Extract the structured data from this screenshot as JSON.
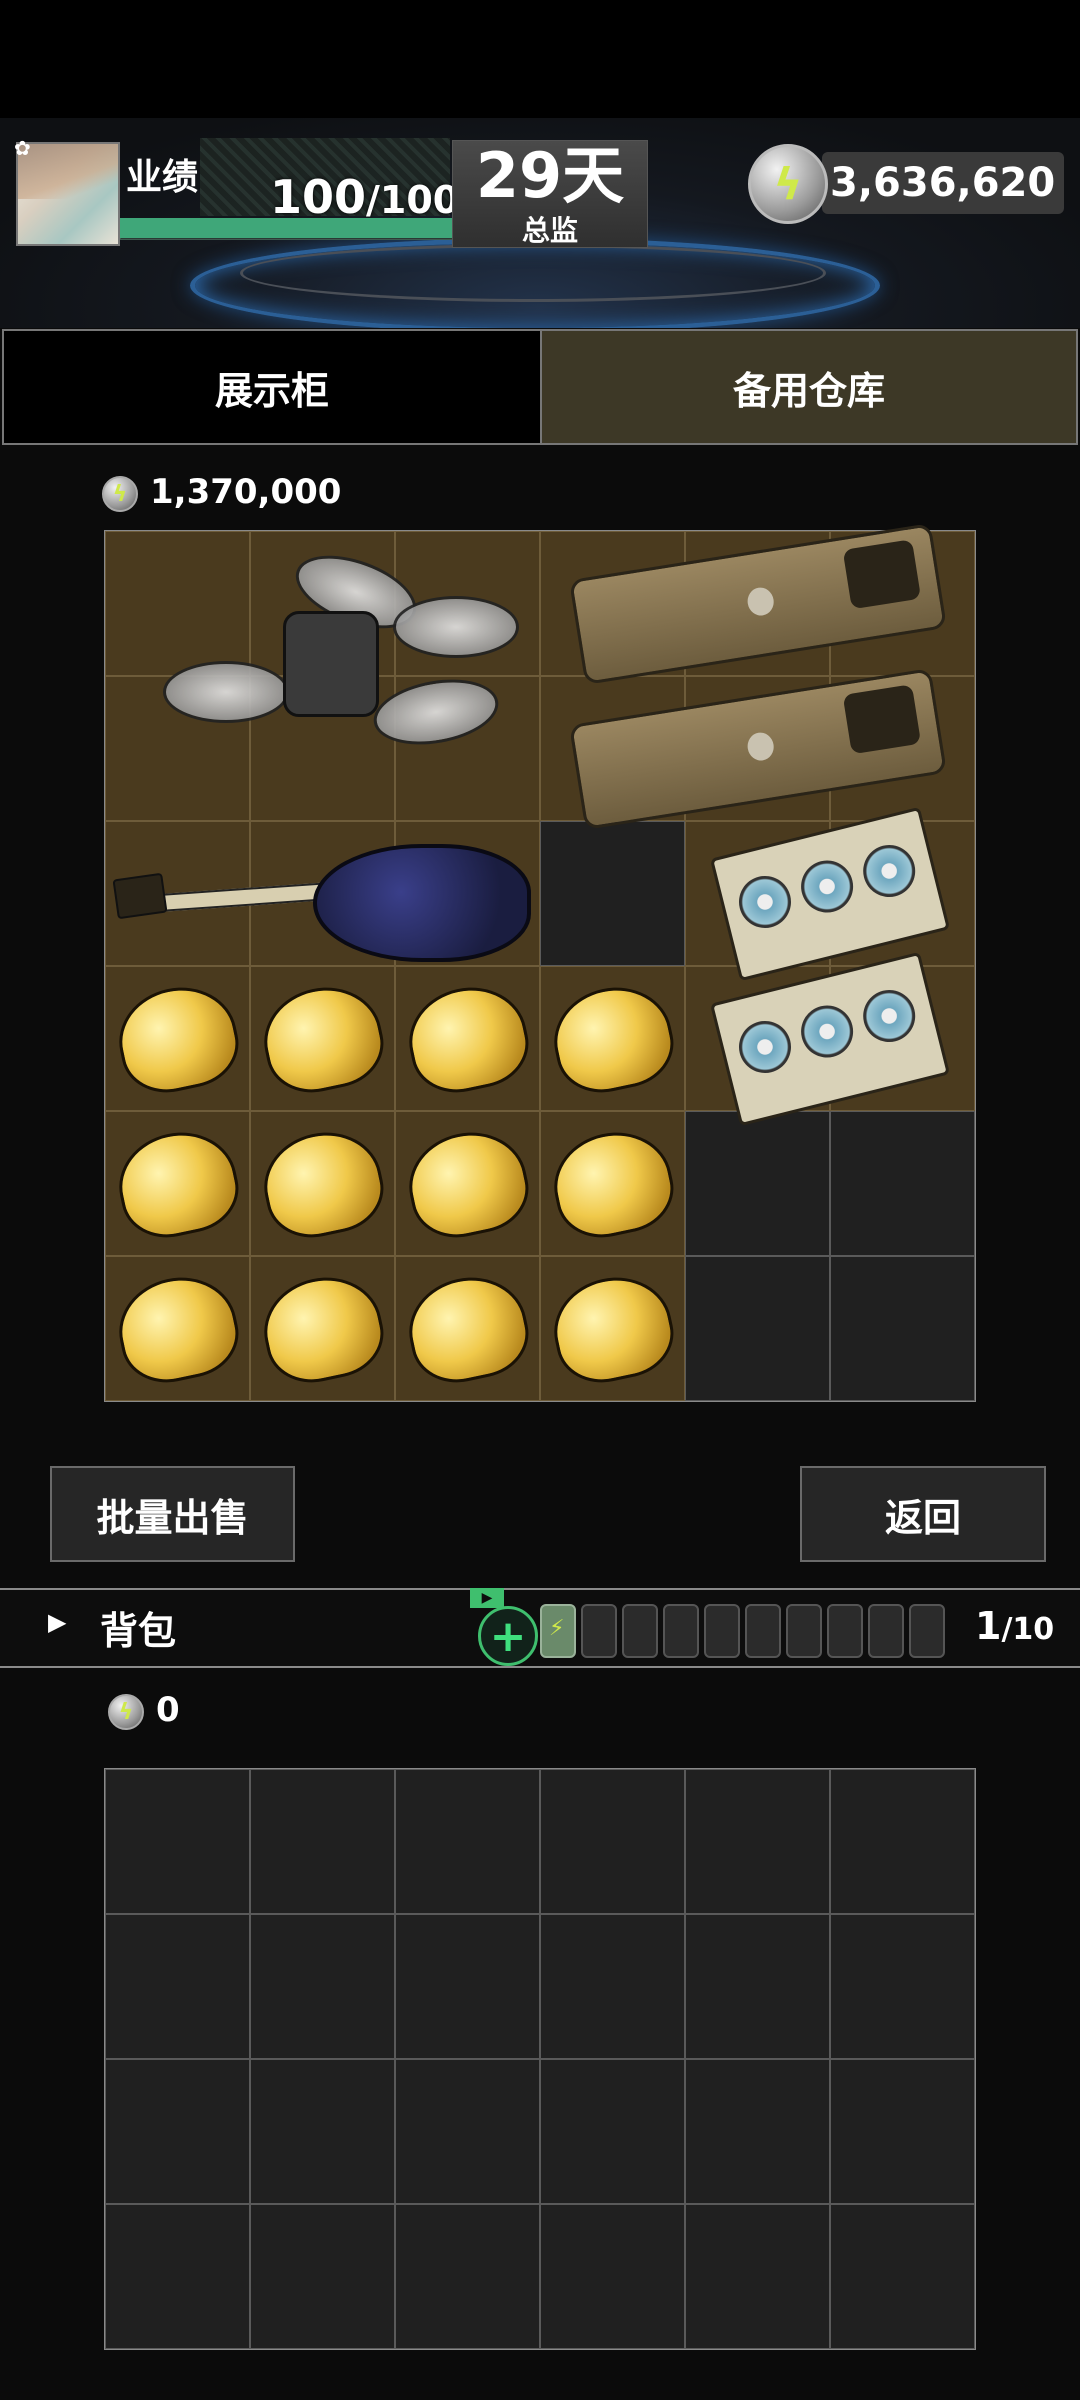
{
  "header": {
    "performance_label": "业绩",
    "performance_current": "100",
    "performance_max": "/100",
    "performance_fraction": 1.0,
    "days_value": "29天",
    "days_label": "总监",
    "coin_total": "3,636,620"
  },
  "tabs": [
    {
      "label": "展示柜",
      "active": false
    },
    {
      "label": "备用仓库",
      "active": true
    }
  ],
  "storage": {
    "value": "1,370,000",
    "items": [
      {
        "name": "drone",
        "col": 0,
        "row": 0,
        "w": 3,
        "h": 2
      },
      {
        "name": "phone",
        "col": 3,
        "row": 0,
        "w": 3,
        "h": 1
      },
      {
        "name": "phone",
        "col": 3,
        "row": 1,
        "w": 3,
        "h": 1
      },
      {
        "name": "guitar",
        "col": 0,
        "row": 2,
        "w": 3,
        "h": 1
      },
      {
        "name": "gpu",
        "col": 4,
        "row": 2,
        "w": 2,
        "h": 1
      },
      {
        "name": "gpu",
        "col": 4,
        "row": 3,
        "w": 2,
        "h": 1
      },
      {
        "name": "gold-nugget",
        "col": 0,
        "row": 3,
        "w": 1,
        "h": 1
      },
      {
        "name": "gold-nugget",
        "col": 1,
        "row": 3,
        "w": 1,
        "h": 1
      },
      {
        "name": "gold-nugget",
        "col": 2,
        "row": 3,
        "w": 1,
        "h": 1
      },
      {
        "name": "gold-nugget",
        "col": 3,
        "row": 3,
        "w": 1,
        "h": 1
      },
      {
        "name": "gold-nugget",
        "col": 0,
        "row": 4,
        "w": 1,
        "h": 1
      },
      {
        "name": "gold-nugget",
        "col": 1,
        "row": 4,
        "w": 1,
        "h": 1
      },
      {
        "name": "gold-nugget",
        "col": 2,
        "row": 4,
        "w": 1,
        "h": 1
      },
      {
        "name": "gold-nugget",
        "col": 3,
        "row": 4,
        "w": 1,
        "h": 1
      },
      {
        "name": "gold-nugget",
        "col": 0,
        "row": 5,
        "w": 1,
        "h": 1
      },
      {
        "name": "gold-nugget",
        "col": 1,
        "row": 5,
        "w": 1,
        "h": 1
      },
      {
        "name": "gold-nugget",
        "col": 2,
        "row": 5,
        "w": 1,
        "h": 1
      },
      {
        "name": "gold-nugget",
        "col": 3,
        "row": 5,
        "w": 1,
        "h": 1
      }
    ],
    "grid_cols": 6,
    "grid_rows": 6,
    "empty_cells": [
      [
        3,
        2
      ],
      [
        4,
        4
      ],
      [
        5,
        4
      ],
      [
        4,
        5
      ],
      [
        5,
        5
      ]
    ]
  },
  "buttons": {
    "batch_sell": "批量出售",
    "back": "返回"
  },
  "backpack": {
    "title": "背包",
    "count_current": "1",
    "count_max": "/10",
    "batteries_full": 1,
    "batteries_total": 10,
    "value": "0",
    "grid_cols": 6,
    "grid_rows": 4
  },
  "icons": {
    "coin": "lightning-coin-icon",
    "add": "plus-circle-icon",
    "expand": "triangle-right-icon",
    "settings": "gear-icon"
  },
  "colors": {
    "accent_green": "#3fa779",
    "tab_active_bg": "#3d3826",
    "item_cell_bg": "#4a3a1e"
  }
}
